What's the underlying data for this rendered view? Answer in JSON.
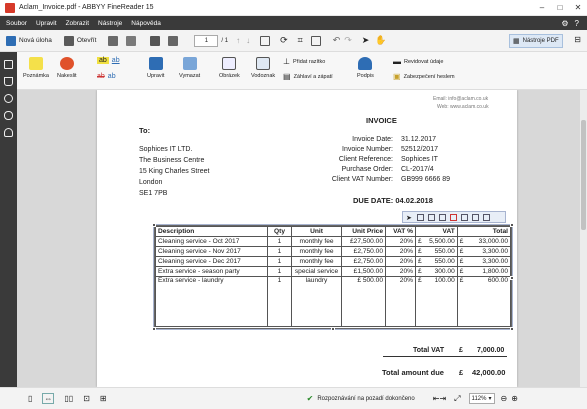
{
  "window": {
    "title": "Aclam_Invoice.pdf - ABBYY FineReader 15"
  },
  "menu": [
    "Soubor",
    "Upravit",
    "Zobrazit",
    "Nástroje",
    "Nápověda"
  ],
  "toolbar": {
    "new_task": "Nová úloha",
    "open": "Otevřít",
    "page_current": "1",
    "page_total": "/ 1",
    "pdf_tools": "Nástroje PDF"
  },
  "ribbon": {
    "note": "Poznámka",
    "highlight": "Nakeslit",
    "edit": "Upravit",
    "erase": "Vymazat",
    "image": "Obrázek",
    "watermark": "Vodoznak",
    "add_stamp": "Přidat razítko",
    "header_footer": "Záhlaví a zápatí",
    "signature": "Podpis",
    "redact": "Revidovat údaje",
    "security": "Zabezpečení heslem"
  },
  "invoice": {
    "email": "Email: info@aclam.co.uk",
    "web": "Web: www.aclam.co.uk",
    "title": "INVOICE",
    "to_label": "To:",
    "address": [
      "Sophices IT LTD.",
      "The Business Centre",
      "15 King Charles Street",
      "London",
      "SE1 7PB"
    ],
    "meta_labels": [
      "Invoice Date:",
      "Invoice Number:",
      "Client Reference:",
      "Purchase Order:",
      "Client VAT Number:"
    ],
    "meta_values": [
      "31.12.2017",
      "52512/2017",
      "Sophices IT",
      "CL-2017/4",
      "GB999 6666 89"
    ],
    "due_date": "DUE DATE: 04.02.2018",
    "headers": [
      "Description",
      "Qty",
      "Unit",
      "Unit Price",
      "VAT %",
      "VAT",
      "Total"
    ],
    "rows": [
      [
        "Cleaning service - Oct 2017",
        "1",
        "monthly fee",
        "£27,500.00",
        "20%",
        "£",
        "5,500.00",
        "£",
        "33,000.00"
      ],
      [
        "Cleaning service - Nov 2017",
        "1",
        "monthly fee",
        "£2,750.00",
        "20%",
        "£",
        "550.00",
        "£",
        "3,300.00"
      ],
      [
        "Cleaning service - Dec 2017",
        "1",
        "monthly fee",
        "£2,750.00",
        "20%",
        "£",
        "550.00",
        "£",
        "3,300.00"
      ],
      [
        "Extra service - season party",
        "1",
        "special service",
        "£1,500.00",
        "20%",
        "£",
        "300.00",
        "£",
        "1,800.00"
      ],
      [
        "Extra service - laundry",
        "1",
        "laundry",
        "£    500.00",
        "20%",
        "£",
        "100.00",
        "£",
        "600.00"
      ]
    ],
    "total_vat_label": "Total VAT",
    "total_vat_cur": "£",
    "total_vat_value": "7,000.00",
    "total_due_label": "Total amount due",
    "total_due_cur": "£",
    "total_due_value": "42,000.00"
  },
  "status": {
    "message": "Rozpoznávání na pozadí dokončeno",
    "zoom": "112%"
  },
  "colors": {
    "accent": "#2e6db4",
    "menubar": "#3a3a3a",
    "sidebar": "#3a3a3a"
  }
}
